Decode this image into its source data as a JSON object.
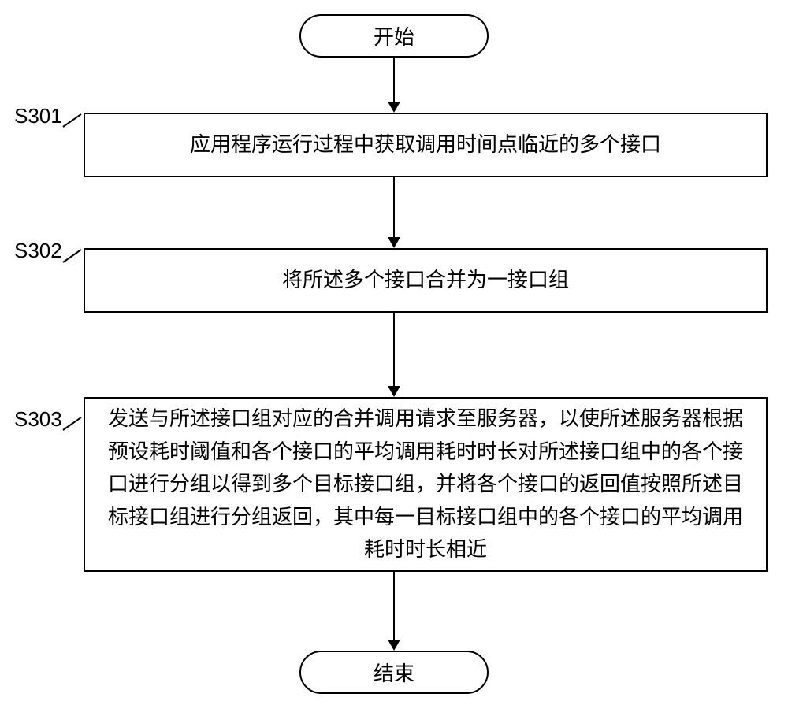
{
  "flowchart": {
    "start": "开始",
    "end": "结束",
    "steps": [
      {
        "id": "S301",
        "text": "应用程序运行过程中获取调用时间点临近的多个接口"
      },
      {
        "id": "S302",
        "text": "将所述多个接口合并为一接口组"
      },
      {
        "id": "S303",
        "text": "发送与所述接口组对应的合并调用请求至服务器，以使所述服务器根据预设耗时阈值和各个接口的平均调用耗时时长对所述接口组中的各个接口进行分组以得到多个目标接口组，并将各个接口的返回值按照所述目标接口组进行分组返回，其中每一目标接口组中的各个接口的平均调用耗时时长相近"
      }
    ]
  }
}
